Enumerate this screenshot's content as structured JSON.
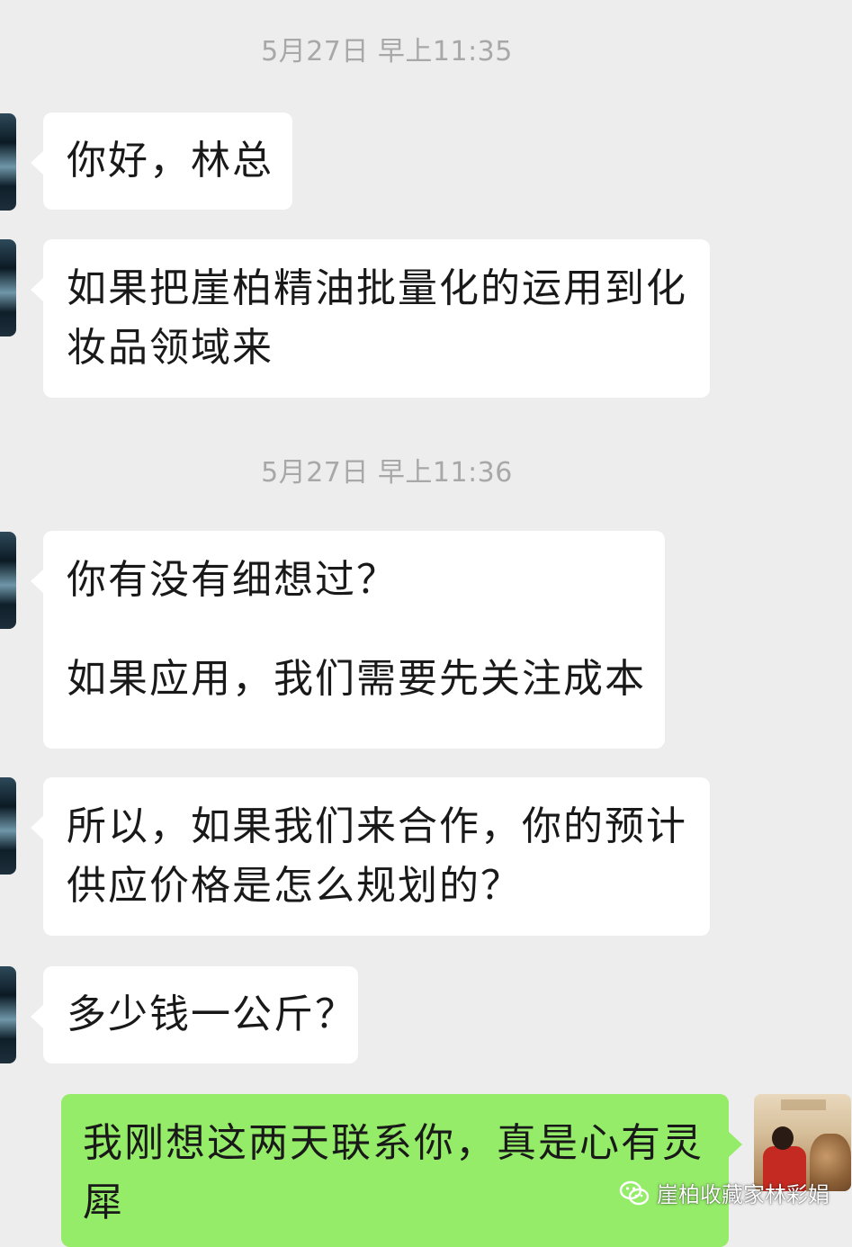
{
  "chat": {
    "timestamps": [
      "5月27日 早上11:35",
      "5月27日 早上11:36"
    ],
    "incoming": [
      {
        "lines": [
          "你好，林总"
        ]
      },
      {
        "lines": [
          "如果把崖柏精油批量化的运用到化",
          "妆品领域来"
        ]
      },
      {
        "lines": [
          "你有没有细想过？",
          "",
          "如果应用，我们需要先关注成本"
        ]
      },
      {
        "lines": [
          "所以，如果我们来合作，你的预计",
          "供应价格是怎么规划的？"
        ]
      },
      {
        "lines": [
          "多少钱一公斤？"
        ]
      }
    ],
    "outgoing": [
      {
        "lines": [
          "我刚想这两天联系你，真是心有灵",
          "犀"
        ]
      }
    ]
  },
  "watermark": {
    "text": "崖柏收藏家林彩娟",
    "icon": "wechat-official-account-icon"
  },
  "colors": {
    "background": "#ededed",
    "incoming_bubble": "#ffffff",
    "outgoing_bubble": "#95ec69",
    "timestamp_text": "#a8a8a8",
    "message_text": "#191919"
  }
}
